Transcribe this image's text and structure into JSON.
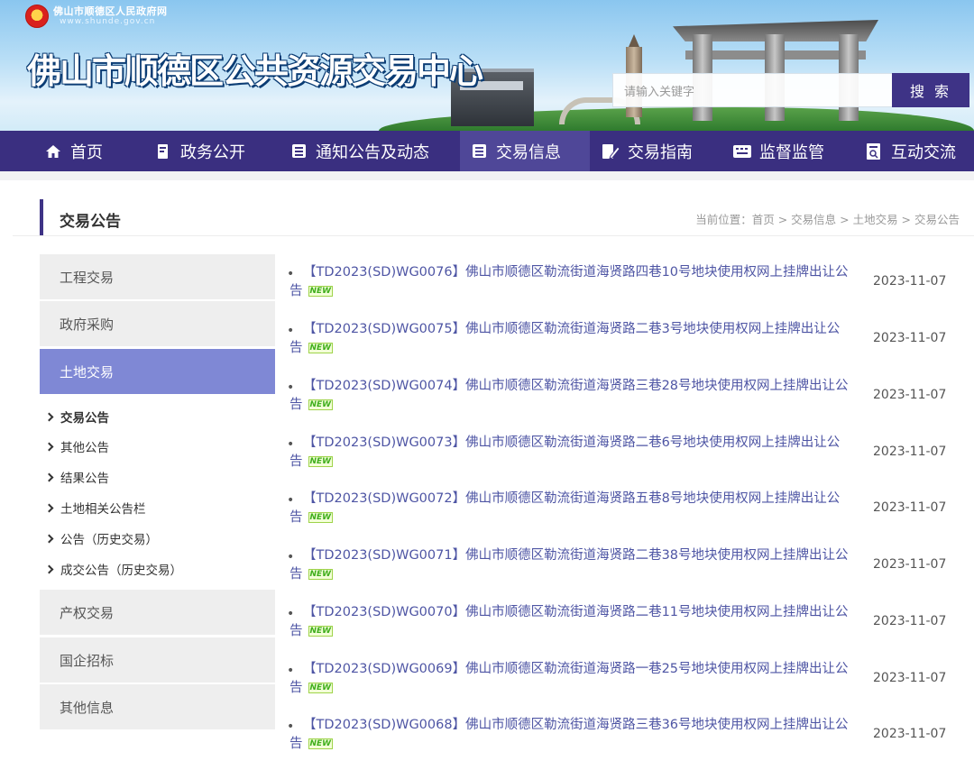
{
  "header": {
    "gov_name": "佛山市顺德区人民政府网",
    "gov_url": "www.shunde.gov.cn",
    "site_title": "佛山市顺德区公共资源交易中心",
    "search_placeholder": "请输入关键字",
    "search_button": "搜 索"
  },
  "nav": [
    {
      "label": "首页",
      "icon": "home-icon"
    },
    {
      "label": "政务公开",
      "icon": "book-icon"
    },
    {
      "label": "通知公告及动态",
      "icon": "list-icon"
    },
    {
      "label": "交易信息",
      "icon": "list-icon"
    },
    {
      "label": "交易指南",
      "icon": "pen-icon"
    },
    {
      "label": "监督监管",
      "icon": "keyboard-icon"
    },
    {
      "label": "互动交流",
      "icon": "search-doc-icon"
    }
  ],
  "page": {
    "section_title": "交易公告",
    "breadcrumb": "当前位置：首页 > 交易信息 > 土地交易 > 交易公告"
  },
  "sidebar": {
    "items": [
      "工程交易",
      "政府采购",
      "土地交易",
      "产权交易",
      "国企招标",
      "其他信息"
    ],
    "active": "土地交易",
    "sub_items": [
      "交易公告",
      "其他公告",
      "结果公告",
      "土地相关公告栏",
      "公告（历史交易）",
      "成交公告（历史交易）"
    ],
    "current_sub": "交易公告"
  },
  "new_tag": "NEW",
  "announcements": [
    {
      "line1": "【TD2023(SD)WG0076】佛山市顺德区勒流街道海贤路四巷10号地块使用权网上挂牌出让公",
      "line2": "告",
      "date": "2023-11-07"
    },
    {
      "line1": "【TD2023(SD)WG0075】佛山市顺德区勒流街道海贤路二巷3号地块使用权网上挂牌出让公",
      "line2": "告",
      "date": "2023-11-07"
    },
    {
      "line1": "【TD2023(SD)WG0074】佛山市顺德区勒流街道海贤路三巷28号地块使用权网上挂牌出让公",
      "line2": "告",
      "date": "2023-11-07"
    },
    {
      "line1": "【TD2023(SD)WG0073】佛山市顺德区勒流街道海贤路二巷6号地块使用权网上挂牌出让公",
      "line2": "告",
      "date": "2023-11-07"
    },
    {
      "line1": "【TD2023(SD)WG0072】佛山市顺德区勒流街道海贤路五巷8号地块使用权网上挂牌出让公",
      "line2": "告",
      "date": "2023-11-07"
    },
    {
      "line1": "【TD2023(SD)WG0071】佛山市顺德区勒流街道海贤路二巷38号地块使用权网上挂牌出让公",
      "line2": "告",
      "date": "2023-11-07"
    },
    {
      "line1": "【TD2023(SD)WG0070】佛山市顺德区勒流街道海贤路二巷11号地块使用权网上挂牌出让公",
      "line2": "告",
      "date": "2023-11-07"
    },
    {
      "line1": "【TD2023(SD)WG0069】佛山市顺德区勒流街道海贤路一巷25号地块使用权网上挂牌出让公",
      "line2": "告",
      "date": "2023-11-07"
    },
    {
      "line1": "【TD2023(SD)WG0068】佛山市顺德区勒流街道海贤路三巷36号地块使用权网上挂牌出让公",
      "line2": "告",
      "date": "2023-11-07"
    }
  ],
  "colors": {
    "nav_bg": "#3a2f80",
    "active_sidebar": "#7f88d5",
    "link": "#4e55a4"
  }
}
